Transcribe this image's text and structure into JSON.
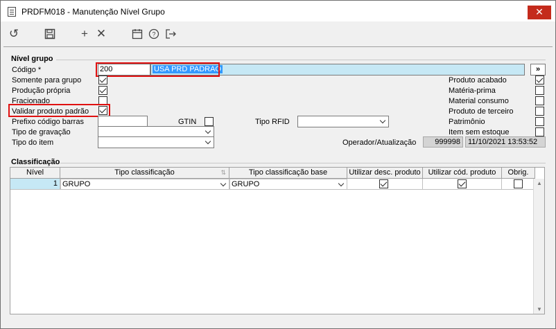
{
  "window": {
    "title": "PRDFM018 - Manutenção Nível Grupo",
    "close_label": "✕"
  },
  "toolbar": {
    "icons": [
      "undo-icon",
      "save-icon",
      "add-icon",
      "delete-icon",
      "calendar-icon",
      "help-icon",
      "exit-icon"
    ]
  },
  "nivel_grupo": {
    "section_title": "Nível grupo",
    "codigo_label": "Código *",
    "codigo_value": "200",
    "descricao_value": "USA PRD PADRAO",
    "lookup_label": "»",
    "somente_label": "Somente para grupo",
    "producao_label": "Produção própria",
    "fracionado_label": "Fracionado",
    "validar_label": "Validar produto padrão",
    "prefixo_label": "Prefixo código barras",
    "prefixo_value": "",
    "gtin_label": "GTIN",
    "tipo_rfid_label": "Tipo RFID",
    "tipo_rfid_value": "",
    "tipo_gravacao_label": "Tipo de gravação",
    "tipo_gravacao_value": "",
    "tipo_item_label": "Tipo do item",
    "tipo_item_value": "",
    "produto_acabado_label": "Produto acabado",
    "materia_prima_label": "Matéria-prima",
    "material_consumo_label": "Material consumo",
    "produto_terceiro_label": "Produto de terceiro",
    "patrimonio_label": "Patrimônio",
    "item_sem_estoque_label": "Item sem estoque",
    "operador_label": "Operador/Atualização",
    "operador_value": "999998",
    "atualizacao_value": "11/10/2021 13:53:52"
  },
  "classificacao": {
    "section_title": "Classificação",
    "columns": [
      "Nível",
      "Tipo classificação",
      "Tipo classificação base",
      "Utilizar desc. produto",
      "Utilizar cód. produto",
      "Obrig."
    ],
    "rows": [
      {
        "nivel": "1",
        "tipo": "GRUPO",
        "tipo_base": "GRUPO"
      }
    ]
  }
}
